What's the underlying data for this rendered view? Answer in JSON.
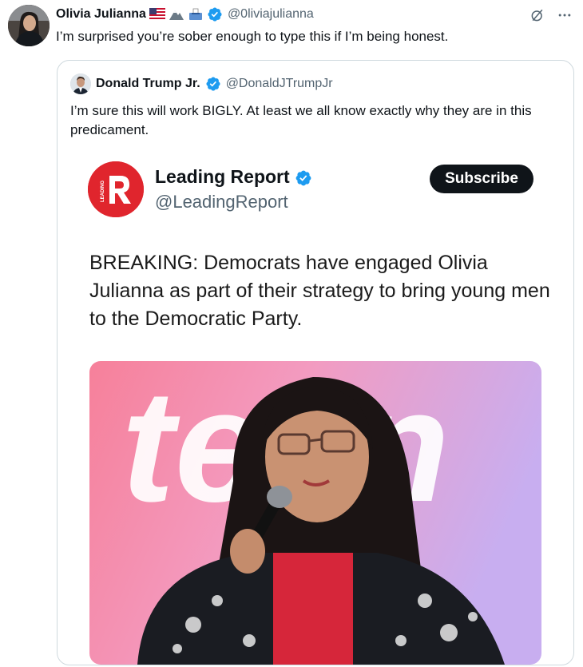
{
  "tweet": {
    "author_name": "Olivia Julianna",
    "author_handle": "@0liviajulianna",
    "emoji_icons": [
      "us-flag-icon",
      "mountain-icon",
      "ballot-box-icon"
    ],
    "text": "I’m surprised you’re sober enough to type this if I’m being honest.",
    "top_icons": [
      "grok-icon",
      "more-icon"
    ]
  },
  "quote": {
    "author_name": "Donald Trump Jr.",
    "author_handle": "@DonaldJTrumpJr",
    "text": "I’m sure this will work BIGLY. At least we all know exactly why they are in this predicament.",
    "embed": {
      "logo_text": "LEADING",
      "account_name": "Leading Report",
      "account_handle": "@LeadingReport",
      "subscribe_label": "Subscribe",
      "headline": "BREAKING: Democrats have engaged Olivia Julianna as part of their strategy to bring young men to the Democratic Party.",
      "photo_backdrop_text": "teen"
    }
  },
  "colors": {
    "verified_blue": "#1d9bf0",
    "leading_red": "#e0252d",
    "secondary_text": "#536471",
    "border": "#cfd9de"
  }
}
